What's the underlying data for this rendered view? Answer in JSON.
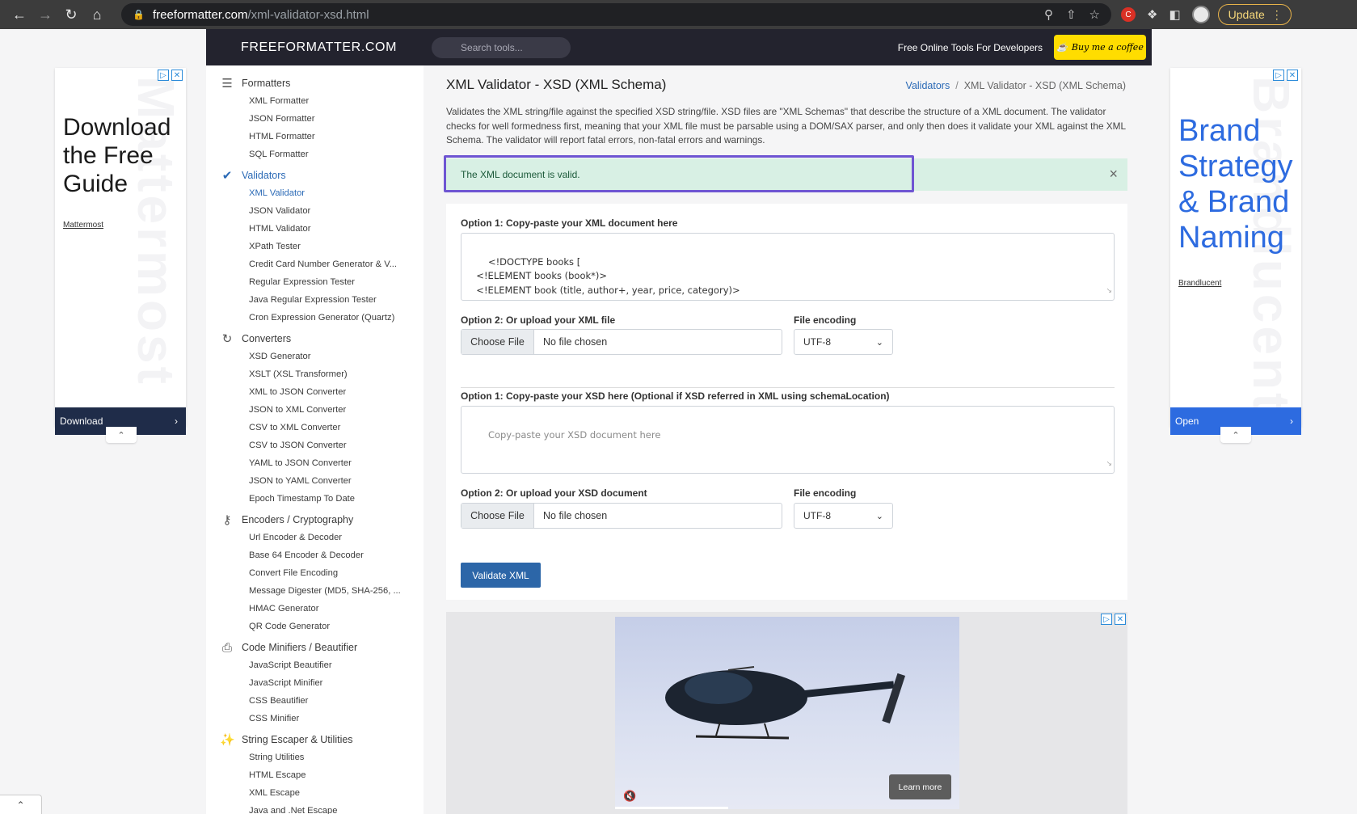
{
  "browser": {
    "url_host": "freeformatter.com",
    "url_path": "/xml-validator-xsd.html",
    "update_label": "Update"
  },
  "header": {
    "logo": "FREEFORMATTER.COM",
    "search_placeholder": "Search tools...",
    "tagline": "Free Online Tools For Developers",
    "coffee_label": "Buy me a coffee"
  },
  "sidebar": {
    "categories": [
      {
        "label": "Formatters",
        "icon": "list-icon",
        "items": [
          "XML Formatter",
          "JSON Formatter",
          "HTML Formatter",
          "SQL Formatter"
        ]
      },
      {
        "label": "Validators",
        "icon": "checkmark-icon",
        "items": [
          "XML Validator",
          "JSON Validator",
          "HTML Validator",
          "XPath Tester",
          "Credit Card Number Generator & V...",
          "Regular Expression Tester",
          "Java Regular Expression Tester",
          "Cron Expression Generator (Quartz)"
        ]
      },
      {
        "label": "Converters",
        "icon": "refresh-icon",
        "items": [
          "XSD Generator",
          "XSLT (XSL Transformer)",
          "XML to JSON Converter",
          "JSON to XML Converter",
          "CSV to XML Converter",
          "CSV to JSON Converter",
          "YAML to JSON Converter",
          "JSON to YAML Converter",
          "Epoch Timestamp To Date"
        ]
      },
      {
        "label": "Encoders / Cryptography",
        "icon": "key-icon",
        "items": [
          "Url Encoder & Decoder",
          "Base 64 Encoder & Decoder",
          "Convert File Encoding",
          "Message Digester (MD5, SHA-256, ...",
          "HMAC Generator",
          "QR Code Generator"
        ]
      },
      {
        "label": "Code Minifiers / Beautifier",
        "icon": "file-icon",
        "items": [
          "JavaScript Beautifier",
          "JavaScript Minifier",
          "CSS Beautifier",
          "CSS Minifier"
        ]
      },
      {
        "label": "String Escaper & Utilities",
        "icon": "wand-icon",
        "items": [
          "String Utilities",
          "HTML Escape",
          "XML Escape",
          "Java and .Net Escape"
        ]
      }
    ],
    "active_category": "Validators",
    "active_item": "XML Validator"
  },
  "main": {
    "title": "XML Validator - XSD (XML Schema)",
    "breadcrumb_link": "Validators",
    "breadcrumb_sep": "/",
    "breadcrumb_current": "XML Validator - XSD (XML Schema)",
    "description": "Validates the XML string/file against the specified XSD string/file. XSD files are \"XML Schemas\" that describe the structure of a XML document. The validator checks for well formedness first, meaning that your XML file must be parsable using a DOM/SAX parser, and only then does it validate your XML against the XML Schema. The validator will report fatal errors, non-fatal errors and warnings.",
    "alert_text": "The XML document is valid.",
    "xml_option1_label": "Option 1: Copy-paste your XML document here",
    "xml_value": "<!DOCTYPE books [\n  <!ELEMENT books (book*)>\n  <!ELEMENT book (title, author+, year, price, category)>\n  <!ELEMENT title (#PCDATA)>\n  <!ELEMENT author (#PCDATA)>",
    "xml_option2_label": "Option 2: Or upload your XML file",
    "choose_file": "Choose File",
    "no_file": "No file chosen",
    "file_encoding_label": "File encoding",
    "encoding_value": "UTF-8",
    "xsd_option1_label": "Option 1: Copy-paste your XSD here (Optional if XSD referred in XML using schemaLocation)",
    "xsd_placeholder": "Copy-paste your XSD document here",
    "xsd_option2_label": "Option 2: Or upload your XSD document",
    "validate_label": "Validate XML",
    "learn_more": "Learn more"
  },
  "left_ad": {
    "headline": "Download the Free Guide",
    "brand": "Mattermost",
    "cta": "Download",
    "watermark": "Mattermost"
  },
  "right_ad": {
    "headline": "Brand Strategy & Brand Naming",
    "brand": "Brandlucent",
    "cta": "Open",
    "watermark": "Brandlucent"
  }
}
